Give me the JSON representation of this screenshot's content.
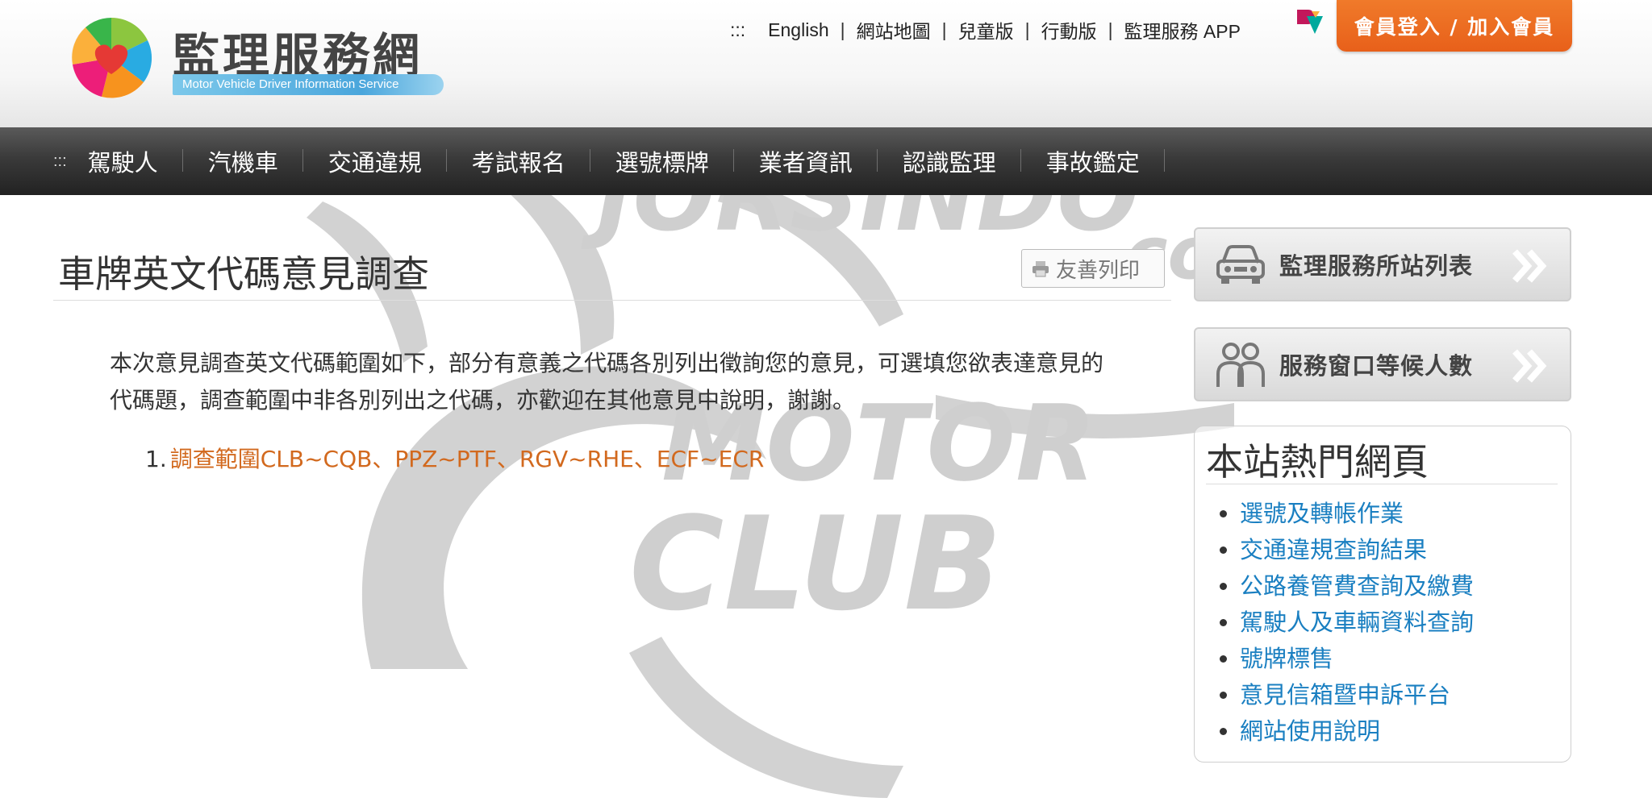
{
  "header": {
    "site_title": "監理服務網",
    "site_subtitle": "Motor Vehicle Driver Information Service",
    "access_key": ":::",
    "top_links": [
      "English",
      "網站地圖",
      "兒童版",
      "行動版",
      "監理服務 APP"
    ],
    "separator": "|",
    "login_label": "會員登入 / 加入會員"
  },
  "nav": {
    "access_key": ":::",
    "items": [
      "駕駛人",
      "汽機車",
      "交通違規",
      "考試報名",
      "選號標牌",
      "業者資訊",
      "認識監理",
      "事故鑑定"
    ]
  },
  "main": {
    "title": "車牌英文代碼意見調查",
    "print_label": "友善列印",
    "intro": "本次意見調查英文代碼範圍如下，部分有意義之代碼各別列出徵詢您的意見，可選填您欲表達意見的代碼題，調查範圍中非各別列出之代碼，亦歡迎在其他意見中說明，謝謝。",
    "survey_items": [
      {
        "number": "1.",
        "label": "調查範圍CLB~CQB、PPZ~PTF、RGV~RHE、ECF~ECR"
      }
    ]
  },
  "sidebar": {
    "buttons": [
      {
        "label": "監理服務所站列表",
        "icon": "car-icon"
      },
      {
        "label": "服務窗口等候人數",
        "icon": "people-icon"
      }
    ],
    "popular": {
      "title": "本站熱門網頁",
      "items": [
        "選號及轉帳作業",
        "交通違規查詢結果",
        "公路養管費查詢及繳費",
        "駕駛人及車輛資料查詢",
        "號牌標售",
        "意見信箱暨申訴平台",
        "網站使用說明"
      ]
    }
  },
  "watermark": {
    "lines": [
      "JORSINDO",
      ".com",
      "MOTOR",
      "CLUB"
    ]
  },
  "colors": {
    "accent_orange": "#e8601a",
    "link_blue": "#1a7fc1",
    "survey_link": "#d2691e",
    "nav_dark": "#2e2e2e"
  }
}
